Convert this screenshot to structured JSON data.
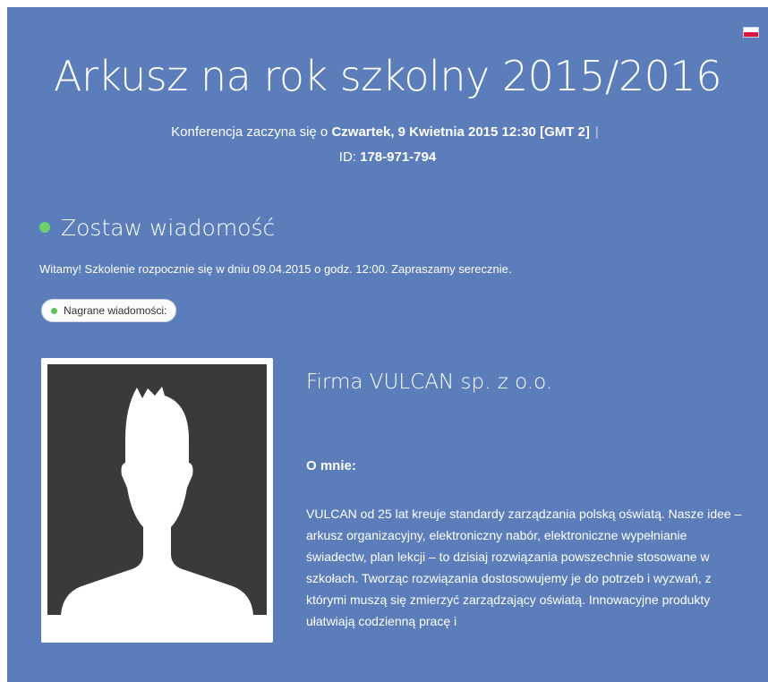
{
  "header": {
    "title": "Arkusz na rok szkolny 2015/2016",
    "start_prefix": "Konferencja zaczyna się o ",
    "start_date": "Czwartek, 9 Kwietnia 2015 12:30 [GMT 2]",
    "separator": "|",
    "id_label": "ID: ",
    "id_value": "178-971-794"
  },
  "language_flag": {
    "icon": "poland-flag-icon",
    "colors": [
      "#ffffff",
      "#dc143c"
    ]
  },
  "message_section": {
    "title": "Zostaw wiadomość",
    "welcome_text": "Witamy! Szkolenie rozpocznie się w dniu 09.04.2015 o godz. 12:00. Zapraszamy serecznie.",
    "recorded_button_label": "Nagrane wiadomości:"
  },
  "presenter": {
    "avatar_icon": "user-silhouette-icon",
    "name": "Firma VULCAN sp. z o.o.",
    "about_label": "O mnie:",
    "about_text": "VULCAN od 25 lat kreuje standardy zarządzania polską oświatą. Nasze idee – arkusz organizacyjny, elektroniczny nabór, elektroniczne wypełnianie świadectw, plan lekcji – to dzisiaj rozwiązania powszechnie stosowane w szkołach. Tworząc rozwiązania dostosowujemy je do potrzeb i wyzwań, z którymi muszą się zmierzyć zarządzający oświatą. Innowacyjne produkty ułatwiają codzienną pracę i"
  },
  "colors": {
    "background": "#5b7dba",
    "status_green": "#6fd16a",
    "avatar_bg": "#3a3a3a"
  }
}
